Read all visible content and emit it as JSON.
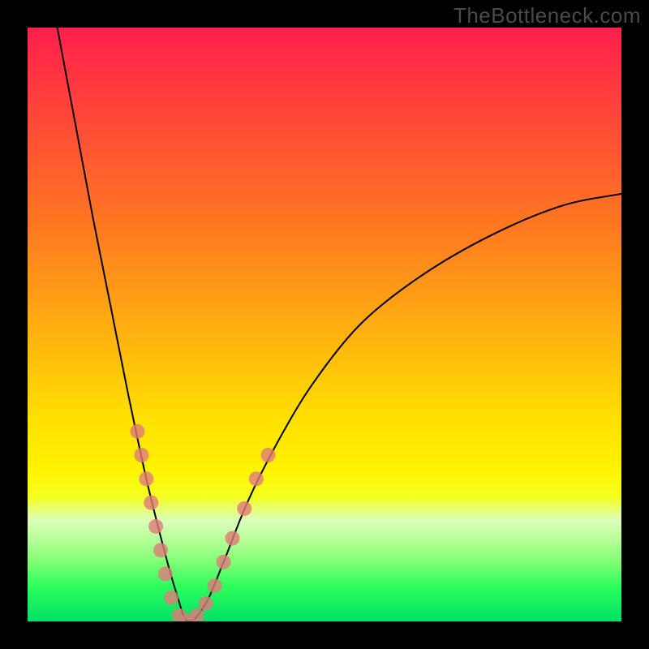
{
  "watermark": "TheBottleneck.com",
  "colors": {
    "gradient_top": "#ff1f4b",
    "gradient_mid1": "#ff9a15",
    "gradient_mid2": "#fff200",
    "gradient_bottom": "#00e066",
    "curve": "#000000",
    "points": "#e07a7a",
    "background": "#000000"
  },
  "plot": {
    "viewbox_w": 732,
    "viewbox_h": 732
  },
  "chart_data": {
    "type": "line",
    "title": "",
    "xlabel": "",
    "ylabel": "",
    "xlim": [
      0,
      100
    ],
    "ylim": [
      0,
      100
    ],
    "notes": "V-shaped bottleneck curve. x≈0→100 across plot width, y≈0→100 bottom→top. Minimum near x≈27 y≈0. Left branch steep to y≈100 at x≈5; right branch shallower, asymptoting near y≈72 at x≈100.",
    "curve_samples": [
      {
        "x": 5,
        "y": 100
      },
      {
        "x": 8,
        "y": 84
      },
      {
        "x": 11,
        "y": 68
      },
      {
        "x": 14,
        "y": 53
      },
      {
        "x": 17,
        "y": 38
      },
      {
        "x": 20,
        "y": 24
      },
      {
        "x": 23,
        "y": 12
      },
      {
        "x": 25,
        "y": 5
      },
      {
        "x": 27,
        "y": 0
      },
      {
        "x": 30,
        "y": 3
      },
      {
        "x": 33,
        "y": 10
      },
      {
        "x": 37,
        "y": 20
      },
      {
        "x": 42,
        "y": 30
      },
      {
        "x": 48,
        "y": 40
      },
      {
        "x": 56,
        "y": 50
      },
      {
        "x": 66,
        "y": 58
      },
      {
        "x": 78,
        "y": 65
      },
      {
        "x": 90,
        "y": 70
      },
      {
        "x": 100,
        "y": 72
      }
    ],
    "scatter_points": [
      {
        "x": 18.5,
        "y": 32
      },
      {
        "x": 19.2,
        "y": 28
      },
      {
        "x": 20.0,
        "y": 24
      },
      {
        "x": 20.8,
        "y": 20
      },
      {
        "x": 21.6,
        "y": 16
      },
      {
        "x": 22.4,
        "y": 12
      },
      {
        "x": 23.2,
        "y": 8
      },
      {
        "x": 24.2,
        "y": 4
      },
      {
        "x": 25.5,
        "y": 1
      },
      {
        "x": 27.0,
        "y": 0
      },
      {
        "x": 28.5,
        "y": 1
      },
      {
        "x": 30.0,
        "y": 3
      },
      {
        "x": 31.5,
        "y": 6
      },
      {
        "x": 33.0,
        "y": 10
      },
      {
        "x": 34.5,
        "y": 14
      },
      {
        "x": 36.5,
        "y": 19
      },
      {
        "x": 38.5,
        "y": 24
      },
      {
        "x": 40.5,
        "y": 28
      }
    ]
  }
}
